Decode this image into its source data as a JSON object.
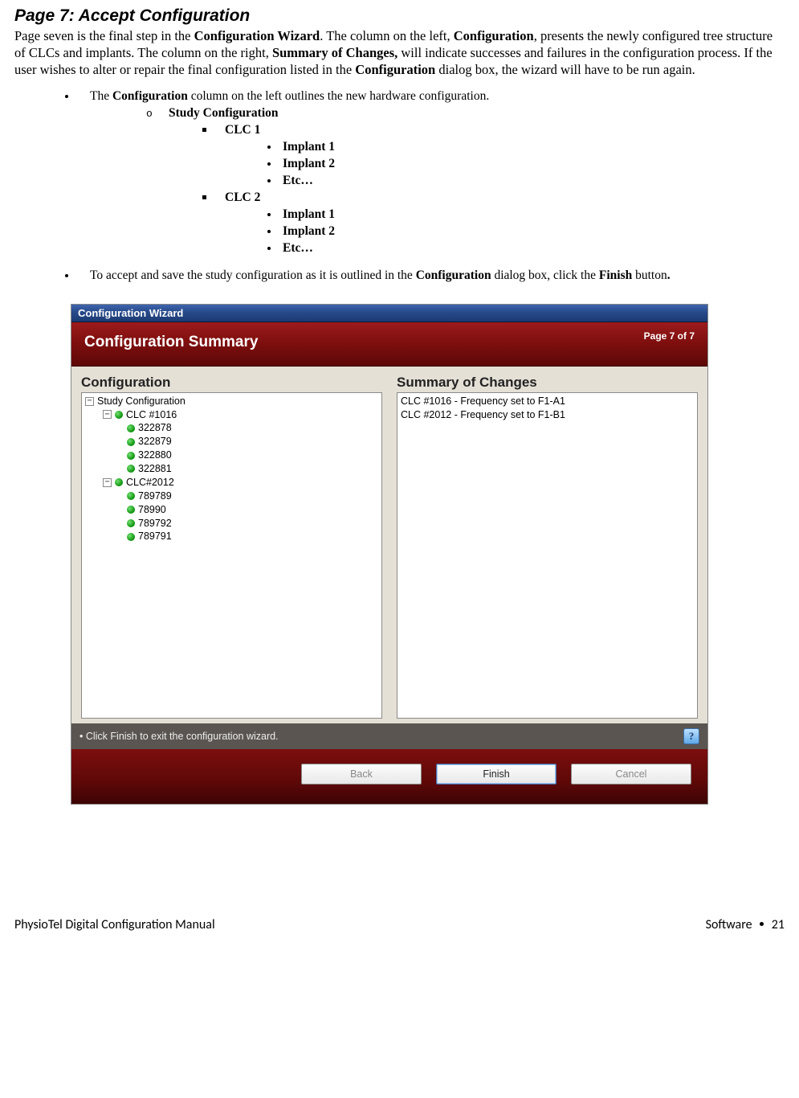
{
  "heading": "Page 7: Accept Configuration",
  "intro_parts": {
    "p1a": "Page seven is the final step in the ",
    "p1b": "Configuration Wizard",
    "p1c": ".  The column on the left, ",
    "p1d": "Configuration",
    "p1e": ", presents the newly configured tree structure of CLCs and implants. The column on the right, ",
    "p1f": "Summary of Changes,",
    "p1g": " will indicate successes and failures in the configuration process.  If the user wishes to alter or repair the final configuration listed in the ",
    "p1h": "Configuration",
    "p1i": " dialog box, the wizard will have to be run again."
  },
  "bullet1": {
    "a": "The ",
    "b": "Configuration",
    "c": " column on the left outlines the new hardware configuration."
  },
  "tree_labels": {
    "study_config": "Study Configuration",
    "clc1": "CLC 1",
    "clc2": "CLC 2",
    "impl1": "Implant 1",
    "impl2": "Implant 2",
    "etc": "Etc…"
  },
  "bullet2": {
    "a": "To accept and save the study configuration as it is outlined in the ",
    "b": "Configuration",
    "c": " dialog box, click the ",
    "d": "Finish",
    "e": " button",
    "f": "."
  },
  "wizard": {
    "titlebar": "Configuration Wizard",
    "banner_title": "Configuration Summary",
    "banner_page": "Page 7 of 7",
    "col_left_title": "Configuration",
    "col_right_title": "Summary of Changes",
    "hint": "• Click Finish to exit the configuration wizard.",
    "buttons": {
      "back": "Back",
      "finish": "Finish",
      "cancel": "Cancel"
    },
    "tree": {
      "root": "Study Configuration",
      "clc1": "CLC #1016",
      "clc1_kids": [
        "322878",
        "322879",
        "322880",
        "322881"
      ],
      "clc2": "CLC#2012",
      "clc2_kids": [
        "789789",
        "78990",
        "789792",
        "789791"
      ]
    },
    "summary": [
      "CLC #1016 - Frequency set to F1-A1",
      "CLC #2012 - Frequency set to F1-B1"
    ]
  },
  "footer": {
    "left": "PhysioTel Digital Configuration Manual",
    "right_a": "Software",
    "right_b": "21"
  }
}
